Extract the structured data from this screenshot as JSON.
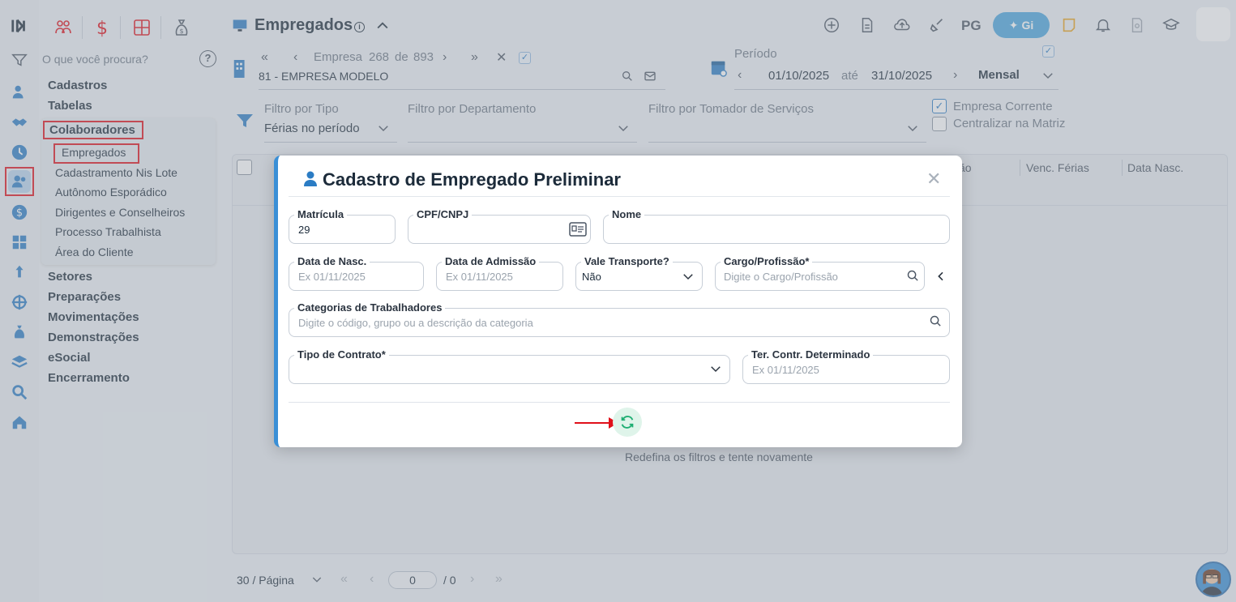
{
  "colors": {
    "accent": "#3a8fd6",
    "brand_dark": "#1c2b3a",
    "highlight_red": "#e0101a",
    "refresh_green": "#1fae73",
    "gi_button": "#4aa5de"
  },
  "top_icons": [
    "people-icon",
    "dollar-icon",
    "calculator-icon",
    "money-bag-icon"
  ],
  "search": {
    "placeholder": "O que você procura?"
  },
  "menu": {
    "main_top": [
      "Cadastros",
      "Tabelas"
    ],
    "colaboradores": "Colaboradores",
    "sub": [
      "Empregados",
      "Cadastramento Nis Lote",
      "Autônomo Esporádico",
      "Dirigentes e Conselheiros",
      "Processo Trabalhista",
      "Área do Cliente"
    ],
    "main_bottom": [
      "Setores",
      "Preparações",
      "Movimentações",
      "Demonstrações",
      "eSocial",
      "Encerramento"
    ]
  },
  "header": {
    "title": "Empregados",
    "pg_label": "PG",
    "gi_label": "Gi"
  },
  "empresa": {
    "label": "Empresa",
    "current": "268",
    "de": "de",
    "total": "893",
    "name": "81 - EMPRESA MODELO"
  },
  "periodo": {
    "label": "Período",
    "start": "01/10/2025",
    "ate": "até",
    "end": "31/10/2025",
    "mode": "Mensal"
  },
  "filters": {
    "tipo_label": "Filtro por Tipo",
    "tipo_value": "Férias no período",
    "departamento_label": "Filtro por Departamento",
    "tomador_label": "Filtro por Tomador de Serviços",
    "empresa_corrente": "Empresa Corrente",
    "centralizar": "Centralizar na Matriz"
  },
  "table": {
    "columns_visible": [
      "ão",
      "Venc. Férias",
      "Data Nasc."
    ],
    "empty_message": "Redefina os filtros e tente novamente"
  },
  "pagination": {
    "per_page": "30 / Página",
    "page": "0",
    "of": "/ 0"
  },
  "modal": {
    "title": "Cadastro de Empregado Preliminar",
    "matricula_label": "Matrícula",
    "matricula_value": "29",
    "cpf_label": "CPF/CNPJ",
    "nome_label": "Nome",
    "nasc_label": "Data de Nasc.",
    "nasc_placeholder": "Ex 01/11/2025",
    "admissao_label": "Data de Admissão",
    "admissao_placeholder": "Ex 01/11/2025",
    "vale_label": "Vale Transporte?",
    "vale_value": "Não",
    "cargo_label": "Cargo/Profissão*",
    "cargo_placeholder": "Digite o Cargo/Profissão",
    "categorias_label": "Categorias de Trabalhadores",
    "categorias_placeholder": "Digite o código, grupo ou a descrição da categoria",
    "contrato_label": "Tipo de Contrato*",
    "ter_label": "Ter. Contr. Determinado",
    "ter_placeholder": "Ex 01/11/2025"
  }
}
